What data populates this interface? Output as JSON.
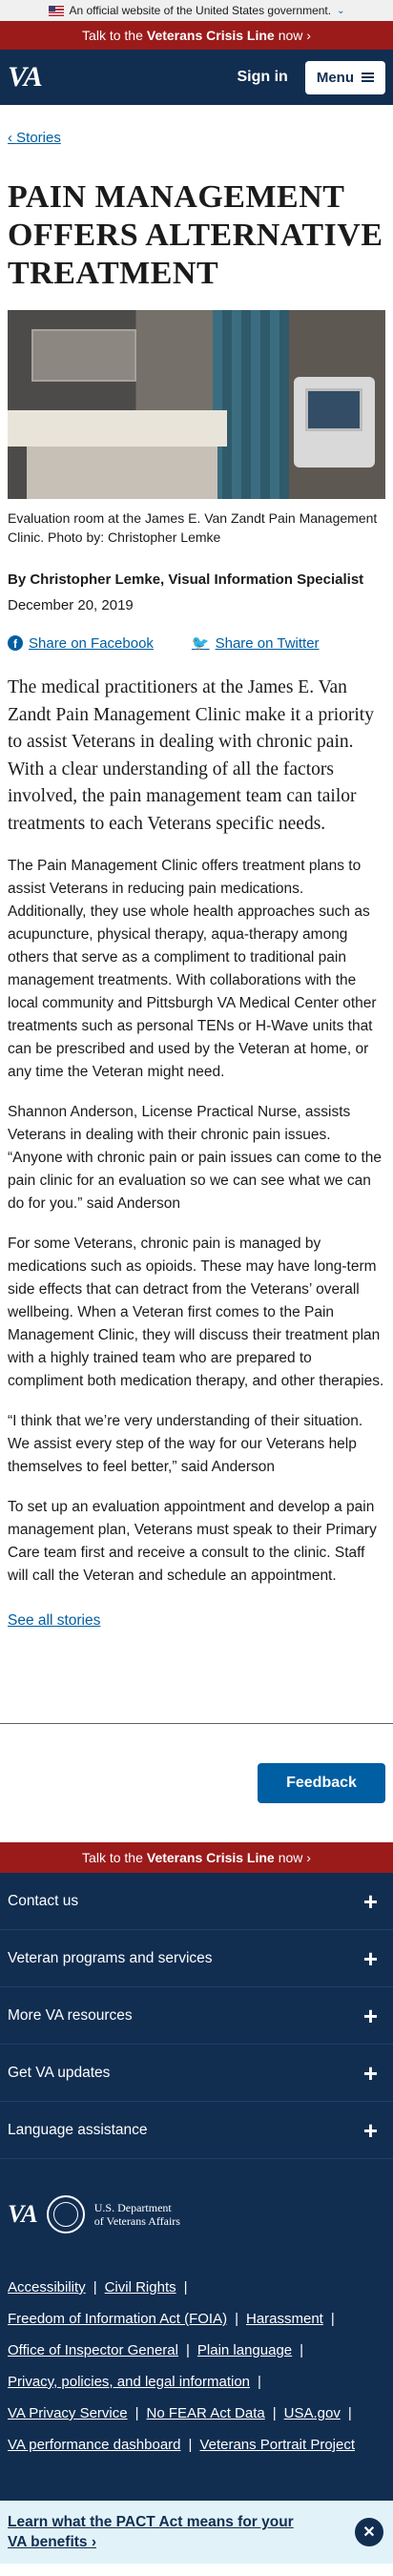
{
  "gov_banner": {
    "text": "An official website of the United States government.",
    "chevron": "⌄"
  },
  "crisis_top": {
    "pre": "Talk to the",
    "bold": "Veterans Crisis Line",
    "post": "now ›"
  },
  "header": {
    "logo": "VA",
    "sign_in": "Sign in",
    "menu": "Menu"
  },
  "breadcrumb": {
    "label": "Stories",
    "chevron": "‹"
  },
  "article": {
    "title": "PAIN MANAGEMENT OFFERS ALTERNATIVE TREATMENT",
    "caption": "Evaluation room at the James E. Van Zandt Pain Management Clinic. Photo by: Christopher Lemke",
    "byline": "By Christopher Lemke, Visual Information Specialist",
    "date": "December 20, 2019",
    "share_facebook": "Share on Facebook",
    "share_twitter": "Share on Twitter",
    "lead": "The medical practitioners at the James E. Van Zandt Pain Management Clinic make it a priority to assist Veterans in dealing with chronic pain. With a clear understanding of all the factors involved, the pain management team can tailor treatments to each Veterans specific needs.",
    "paragraphs": [
      "The Pain Management Clinic offers treatment plans to assist Veterans in reducing pain medications. Additionally, they use whole health approaches such as acupuncture, physical therapy, aqua-therapy among others that serve as a compliment to traditional pain management treatments. With collaborations with the local community and Pittsburgh VA Medical Center other treatments such as personal TENs or H-Wave units that can be prescribed and used by the Veteran at home, or any time the Veteran might need.",
      "Shannon Anderson, License Practical Nurse, assists Veterans in dealing with their chronic pain issues. “Anyone with chronic pain or pain issues can come to the pain clinic for an evaluation so we can see what we can do for you.” said Anderson",
      "For some Veterans, chronic pain is managed by medications such as opioids. These may have long-term side effects that can detract from the Veterans’ overall wellbeing. When a Veteran first comes to the Pain Management Clinic, they will discuss their treatment plan with a highly trained team who are prepared to compliment both medication therapy, and other therapies.",
      "“I think that we’re very understanding of their situation. We assist every step of the way for our Veterans help themselves to feel better,” said Anderson",
      "To set up an evaluation appointment and develop a pain management plan, Veterans must speak to their Primary Care team first and receive a consult to the clinic. Staff will call the Veteran and schedule an appointment."
    ],
    "see_all": "See all stories"
  },
  "feedback": "Feedback",
  "crisis_bottom": {
    "pre": "Talk to the",
    "bold": "Veterans Crisis Line",
    "post": "now ›"
  },
  "footer": {
    "accordion": [
      "Contact us",
      "Veteran programs and services",
      "More VA resources",
      "Get VA updates",
      "Language assistance"
    ],
    "logo": "VA",
    "dept_line1": "U.S. Department",
    "dept_line2": "of Veterans Affairs",
    "links": {
      "accessibility": "Accessibility",
      "civil_rights": "Civil Rights",
      "foia": "Freedom of Information Act (FOIA)",
      "harassment": "Harassment",
      "oig": "Office of Inspector General",
      "plain_language": "Plain language",
      "privacy": "Privacy, policies, and legal information",
      "va_privacy": "VA Privacy Service",
      "no_fear": "No FEAR Act Data",
      "usa_gov": "USA.gov",
      "dashboard": "VA performance dashboard",
      "portrait": "Veterans Portrait Project"
    },
    "separator": "|"
  },
  "pact_banner": {
    "text": "Learn what the PACT Act means for your VA benefits ›"
  },
  "icons": {
    "plus": "plus-icon",
    "close": "close-icon",
    "facebook": "facebook-icon",
    "twitter": "twitter-icon",
    "hamburger": "hamburger-icon"
  },
  "colors": {
    "navy": "#112e51",
    "crisis_red": "#9b1b1b",
    "link_blue": "#005ea2",
    "pact_bg": "#e1f3f8"
  }
}
